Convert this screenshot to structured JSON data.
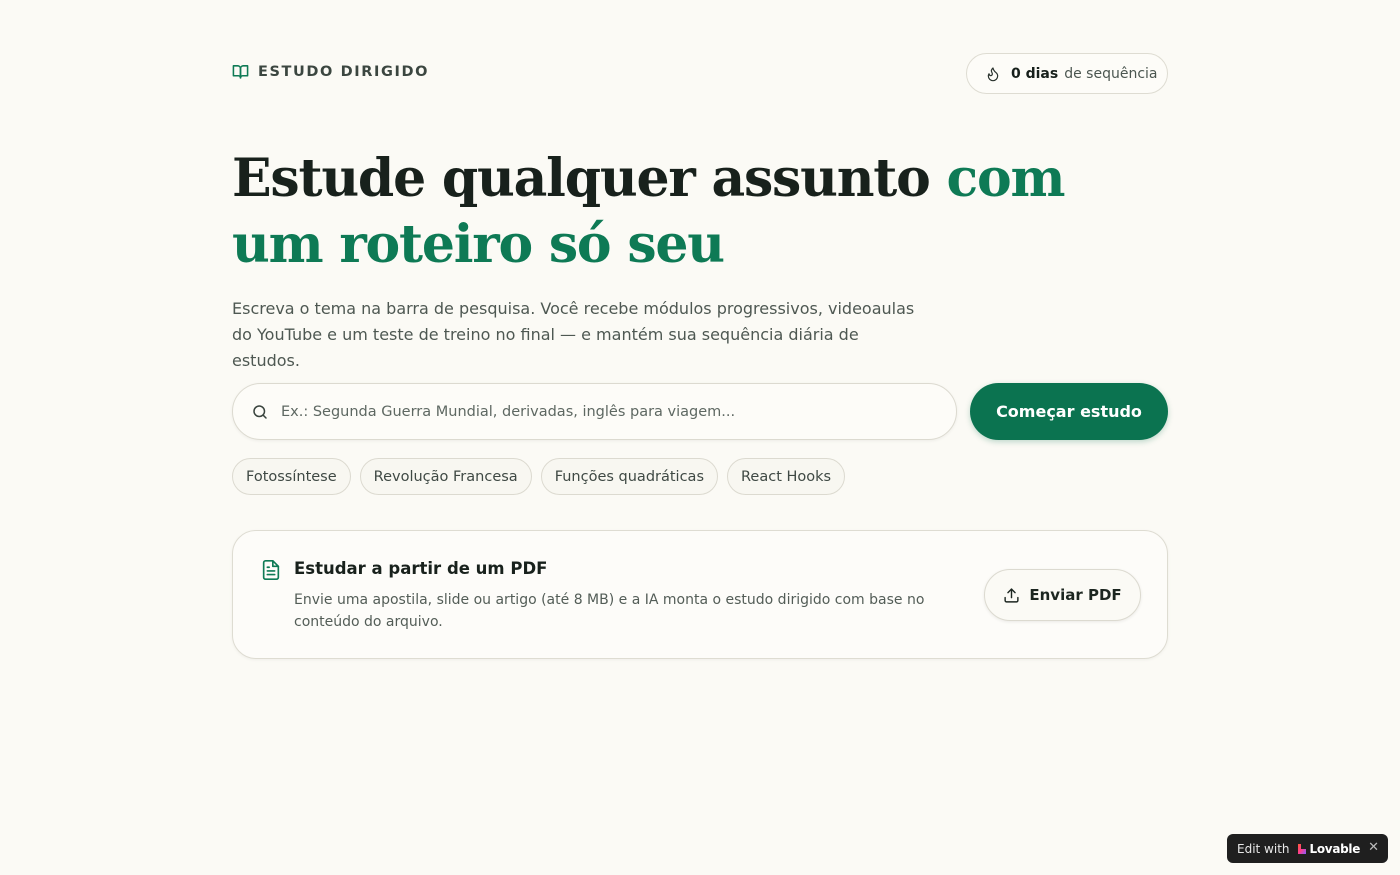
{
  "header": {
    "brand_name": "ESTUDO DIRIGIDO",
    "streak_count": "0 dias",
    "streak_label": "de sequência"
  },
  "hero": {
    "title_part1": "Estude qualquer assunto ",
    "title_accent": "com um roteiro só seu",
    "subtitle": "Escreva o tema na barra de pesquisa. Você recebe módulos progressivos, videoaulas do YouTube e um teste de treino no final — e mantém sua sequência diária de estudos."
  },
  "search": {
    "placeholder": "Ex.: Segunda Guerra Mundial, derivadas, inglês para viagem...",
    "value": "",
    "submit_label": "Começar estudo"
  },
  "suggestions": [
    {
      "label": "Fotossíntese"
    },
    {
      "label": "Revolução Francesa"
    },
    {
      "label": "Funções quadráticas"
    },
    {
      "label": "React Hooks"
    }
  ],
  "pdf_card": {
    "title": "Estudar a partir de um PDF",
    "description": "Envie uma apostila, slide ou artigo (até 8 MB) e a IA monta o estudo dirigido com base no conteúdo do arquivo.",
    "button_label": "Enviar PDF"
  },
  "badge": {
    "prefix": "Edit with",
    "brand": "Lovable",
    "close": "✕"
  },
  "colors": {
    "accent": "#0e7a55",
    "button": "#0b7350",
    "background": "#fbfaf5"
  }
}
